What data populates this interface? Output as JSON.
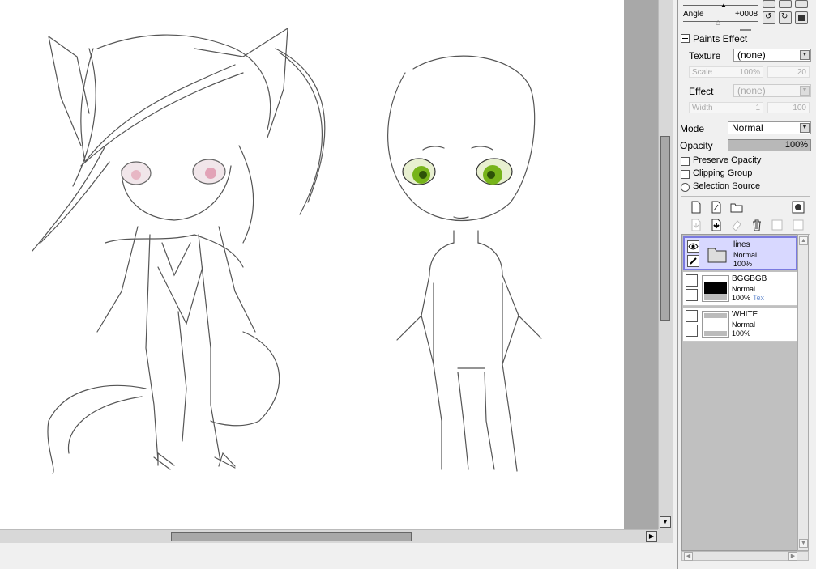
{
  "panel": {
    "top_slider_label": "Angle",
    "angle_label": "Angle",
    "angle_value": "+0008",
    "paints_effect_title": "Paints Effect",
    "texture_label": "Texture",
    "texture_value": "(none)",
    "scale_label": "Scale",
    "scale_value": "100%",
    "scale_num": "20",
    "effect_label": "Effect",
    "effect_value": "(none)",
    "width_label": "Width",
    "width_value": "1",
    "width_num": "100",
    "mode_label": "Mode",
    "mode_value": "Normal",
    "opacity_label": "Opacity",
    "opacity_value": "100%",
    "opacity_fill": 1.0,
    "preserve_opacity": "Preserve Opacity",
    "clipping_group": "Clipping Group",
    "selection_source": "Selection Source"
  },
  "layers": [
    {
      "name": "lines",
      "mode": "Normal",
      "opacity": "100%",
      "extra": "",
      "selected": true,
      "type": "folder"
    },
    {
      "name": "BGGBGB",
      "mode": "Normal",
      "opacity": "100%",
      "extra": "Tex",
      "selected": false,
      "type": "black"
    },
    {
      "name": "WHITE",
      "mode": "Normal",
      "opacity": "100%",
      "extra": "",
      "selected": false,
      "type": "white"
    }
  ],
  "icons": {
    "new_layer": "new-layer-icon",
    "new_linework": "new-linework-layer-icon",
    "new_folder": "new-folder-icon",
    "mask": "layer-mask-icon",
    "delete": "trash-icon"
  }
}
